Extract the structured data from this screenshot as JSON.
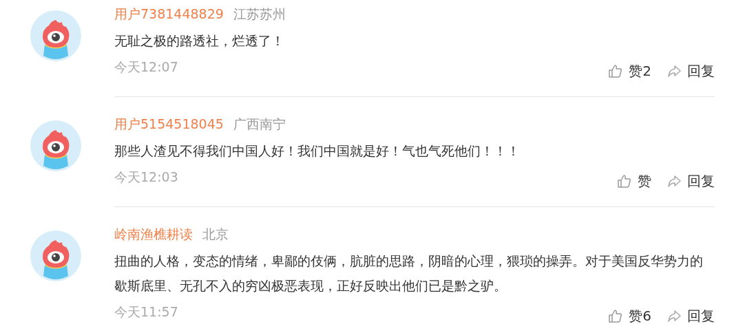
{
  "comments": [
    {
      "user": "用户7381448829",
      "location": "江苏苏州",
      "text": "无耻之极的路透社，烂透了！",
      "time": "今天12:07",
      "like": "赞2",
      "reply": "回复"
    },
    {
      "user": "用户5154518045",
      "location": "广西南宁",
      "text": "那些人渣见不得我们中国人好！我们中国就是好！气也气死他们！！！",
      "time": "今天12:03",
      "like": "赞",
      "reply": "回复"
    },
    {
      "user": "岭南渔樵耕读",
      "location": "北京",
      "text": "扭曲的人格，变态的情绪，卑鄙的伎俩，肮脏的思路，阴暗的心理，猥琐的操弄。对于美国反华势力的歇斯底里、无孔不入的穷凶极恶表现，正好反映出他们已是黔之驴。",
      "time": "今天11:57",
      "like": "赞6",
      "reply": "回复"
    }
  ]
}
